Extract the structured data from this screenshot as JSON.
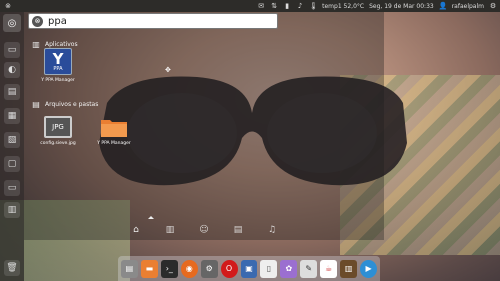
{
  "top_panel": {
    "temp": "temp1 52,0°C",
    "datetime": "Seg, 19 de Mar 00:33",
    "user": "rafaelpalm",
    "icons": [
      "envelope-icon",
      "network-icon",
      "battery-icon",
      "volume-icon",
      "thermometer-icon",
      "session-gear-icon"
    ]
  },
  "search": {
    "query": "ppa"
  },
  "categories": {
    "applications": {
      "label": "Aplicativos",
      "items": [
        {
          "label": "Y PPA Manager",
          "icon_top": "Y",
          "icon_bottom": "PPA"
        }
      ]
    },
    "files": {
      "label": "Arquivos e pastas",
      "items": [
        {
          "label": "config.sieve.jpg",
          "icon": "JPG"
        },
        {
          "label": "Y PPA Manager",
          "icon": "folder-icon"
        }
      ]
    }
  },
  "lenses": [
    "home-lens-icon",
    "applications-lens-icon",
    "social-lens-icon",
    "files-lens-icon",
    "music-lens-icon"
  ],
  "colors": {
    "panel": "#2d2c29",
    "folder": "#ea7f32",
    "ppa_icon": "#2a4c9a"
  }
}
